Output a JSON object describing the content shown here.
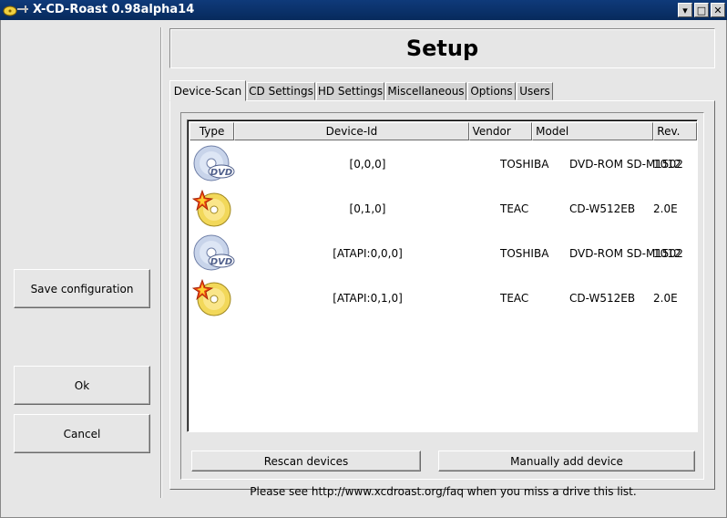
{
  "window": {
    "title": "X-CD-Roast 0.98alpha14",
    "controls": {
      "minimize": "▾",
      "maximize": "□",
      "close": "✕"
    }
  },
  "left": {
    "save_label": "Save configuration",
    "ok_label": "Ok",
    "cancel_label": "Cancel"
  },
  "page_title": "Setup",
  "tabs": [
    {
      "label": "Device-Scan",
      "active": true
    },
    {
      "label": "CD Settings",
      "active": false
    },
    {
      "label": "HD Settings",
      "active": false
    },
    {
      "label": "Miscellaneous",
      "active": false
    },
    {
      "label": "Options",
      "active": false
    },
    {
      "label": "Users",
      "active": false
    }
  ],
  "device_list": {
    "columns": [
      "Type",
      "Device-Id",
      "Vendor",
      "Model",
      "Rev."
    ],
    "rows": [
      {
        "type_icon": "dvd-drive-icon",
        "device_id": "[0,0,0]",
        "vendor": "TOSHIBA",
        "model": "DVD-ROM SD-M1502",
        "rev": "1012"
      },
      {
        "type_icon": "cd-writer-icon",
        "device_id": "[0,1,0]",
        "vendor": "TEAC",
        "model": "CD-W512EB",
        "rev": "2.0E"
      },
      {
        "type_icon": "dvd-drive-icon",
        "device_id": "[ATAPI:0,0,0]",
        "vendor": "TOSHIBA",
        "model": "DVD-ROM SD-M1502",
        "rev": "1012"
      },
      {
        "type_icon": "cd-writer-icon",
        "device_id": "[ATAPI:0,1,0]",
        "vendor": "TEAC",
        "model": "CD-W512EB",
        "rev": "2.0E"
      }
    ]
  },
  "buttons": {
    "rescan_label": "Rescan devices",
    "manual_add_label": "Manually add device"
  },
  "hint_text": "Please see http://www.xcdroast.org/faq when you miss a drive this list.",
  "colors": {
    "titlebar": "#0f3a7a",
    "background": "#e6e6e6",
    "list_background": "#ffffff"
  }
}
